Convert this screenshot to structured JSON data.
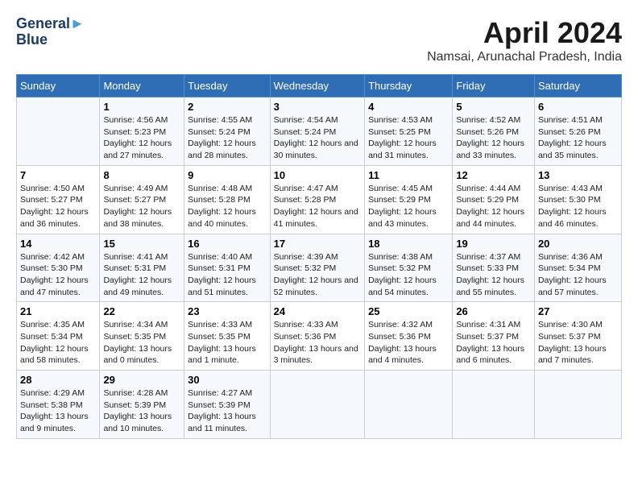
{
  "logo": {
    "line1": "General",
    "line2": "Blue",
    "bird_symbol": "▶"
  },
  "title": "April 2024",
  "subtitle": "Namsai, Arunachal Pradesh, India",
  "weekdays": [
    "Sunday",
    "Monday",
    "Tuesday",
    "Wednesday",
    "Thursday",
    "Friday",
    "Saturday"
  ],
  "weeks": [
    [
      {
        "day": "",
        "sunrise": "",
        "sunset": "",
        "daylight": ""
      },
      {
        "day": "1",
        "sunrise": "Sunrise: 4:56 AM",
        "sunset": "Sunset: 5:23 PM",
        "daylight": "Daylight: 12 hours and 27 minutes."
      },
      {
        "day": "2",
        "sunrise": "Sunrise: 4:55 AM",
        "sunset": "Sunset: 5:24 PM",
        "daylight": "Daylight: 12 hours and 28 minutes."
      },
      {
        "day": "3",
        "sunrise": "Sunrise: 4:54 AM",
        "sunset": "Sunset: 5:24 PM",
        "daylight": "Daylight: 12 hours and 30 minutes."
      },
      {
        "day": "4",
        "sunrise": "Sunrise: 4:53 AM",
        "sunset": "Sunset: 5:25 PM",
        "daylight": "Daylight: 12 hours and 31 minutes."
      },
      {
        "day": "5",
        "sunrise": "Sunrise: 4:52 AM",
        "sunset": "Sunset: 5:26 PM",
        "daylight": "Daylight: 12 hours and 33 minutes."
      },
      {
        "day": "6",
        "sunrise": "Sunrise: 4:51 AM",
        "sunset": "Sunset: 5:26 PM",
        "daylight": "Daylight: 12 hours and 35 minutes."
      }
    ],
    [
      {
        "day": "7",
        "sunrise": "Sunrise: 4:50 AM",
        "sunset": "Sunset: 5:27 PM",
        "daylight": "Daylight: 12 hours and 36 minutes."
      },
      {
        "day": "8",
        "sunrise": "Sunrise: 4:49 AM",
        "sunset": "Sunset: 5:27 PM",
        "daylight": "Daylight: 12 hours and 38 minutes."
      },
      {
        "day": "9",
        "sunrise": "Sunrise: 4:48 AM",
        "sunset": "Sunset: 5:28 PM",
        "daylight": "Daylight: 12 hours and 40 minutes."
      },
      {
        "day": "10",
        "sunrise": "Sunrise: 4:47 AM",
        "sunset": "Sunset: 5:28 PM",
        "daylight": "Daylight: 12 hours and 41 minutes."
      },
      {
        "day": "11",
        "sunrise": "Sunrise: 4:45 AM",
        "sunset": "Sunset: 5:29 PM",
        "daylight": "Daylight: 12 hours and 43 minutes."
      },
      {
        "day": "12",
        "sunrise": "Sunrise: 4:44 AM",
        "sunset": "Sunset: 5:29 PM",
        "daylight": "Daylight: 12 hours and 44 minutes."
      },
      {
        "day": "13",
        "sunrise": "Sunrise: 4:43 AM",
        "sunset": "Sunset: 5:30 PM",
        "daylight": "Daylight: 12 hours and 46 minutes."
      }
    ],
    [
      {
        "day": "14",
        "sunrise": "Sunrise: 4:42 AM",
        "sunset": "Sunset: 5:30 PM",
        "daylight": "Daylight: 12 hours and 47 minutes."
      },
      {
        "day": "15",
        "sunrise": "Sunrise: 4:41 AM",
        "sunset": "Sunset: 5:31 PM",
        "daylight": "Daylight: 12 hours and 49 minutes."
      },
      {
        "day": "16",
        "sunrise": "Sunrise: 4:40 AM",
        "sunset": "Sunset: 5:31 PM",
        "daylight": "Daylight: 12 hours and 51 minutes."
      },
      {
        "day": "17",
        "sunrise": "Sunrise: 4:39 AM",
        "sunset": "Sunset: 5:32 PM",
        "daylight": "Daylight: 12 hours and 52 minutes."
      },
      {
        "day": "18",
        "sunrise": "Sunrise: 4:38 AM",
        "sunset": "Sunset: 5:32 PM",
        "daylight": "Daylight: 12 hours and 54 minutes."
      },
      {
        "day": "19",
        "sunrise": "Sunrise: 4:37 AM",
        "sunset": "Sunset: 5:33 PM",
        "daylight": "Daylight: 12 hours and 55 minutes."
      },
      {
        "day": "20",
        "sunrise": "Sunrise: 4:36 AM",
        "sunset": "Sunset: 5:34 PM",
        "daylight": "Daylight: 12 hours and 57 minutes."
      }
    ],
    [
      {
        "day": "21",
        "sunrise": "Sunrise: 4:35 AM",
        "sunset": "Sunset: 5:34 PM",
        "daylight": "Daylight: 12 hours and 58 minutes."
      },
      {
        "day": "22",
        "sunrise": "Sunrise: 4:34 AM",
        "sunset": "Sunset: 5:35 PM",
        "daylight": "Daylight: 13 hours and 0 minutes."
      },
      {
        "day": "23",
        "sunrise": "Sunrise: 4:33 AM",
        "sunset": "Sunset: 5:35 PM",
        "daylight": "Daylight: 13 hours and 1 minute."
      },
      {
        "day": "24",
        "sunrise": "Sunrise: 4:33 AM",
        "sunset": "Sunset: 5:36 PM",
        "daylight": "Daylight: 13 hours and 3 minutes."
      },
      {
        "day": "25",
        "sunrise": "Sunrise: 4:32 AM",
        "sunset": "Sunset: 5:36 PM",
        "daylight": "Daylight: 13 hours and 4 minutes."
      },
      {
        "day": "26",
        "sunrise": "Sunrise: 4:31 AM",
        "sunset": "Sunset: 5:37 PM",
        "daylight": "Daylight: 13 hours and 6 minutes."
      },
      {
        "day": "27",
        "sunrise": "Sunrise: 4:30 AM",
        "sunset": "Sunset: 5:37 PM",
        "daylight": "Daylight: 13 hours and 7 minutes."
      }
    ],
    [
      {
        "day": "28",
        "sunrise": "Sunrise: 4:29 AM",
        "sunset": "Sunset: 5:38 PM",
        "daylight": "Daylight: 13 hours and 9 minutes."
      },
      {
        "day": "29",
        "sunrise": "Sunrise: 4:28 AM",
        "sunset": "Sunset: 5:39 PM",
        "daylight": "Daylight: 13 hours and 10 minutes."
      },
      {
        "day": "30",
        "sunrise": "Sunrise: 4:27 AM",
        "sunset": "Sunset: 5:39 PM",
        "daylight": "Daylight: 13 hours and 11 minutes."
      },
      {
        "day": "",
        "sunrise": "",
        "sunset": "",
        "daylight": ""
      },
      {
        "day": "",
        "sunrise": "",
        "sunset": "",
        "daylight": ""
      },
      {
        "day": "",
        "sunrise": "",
        "sunset": "",
        "daylight": ""
      },
      {
        "day": "",
        "sunrise": "",
        "sunset": "",
        "daylight": ""
      }
    ]
  ]
}
